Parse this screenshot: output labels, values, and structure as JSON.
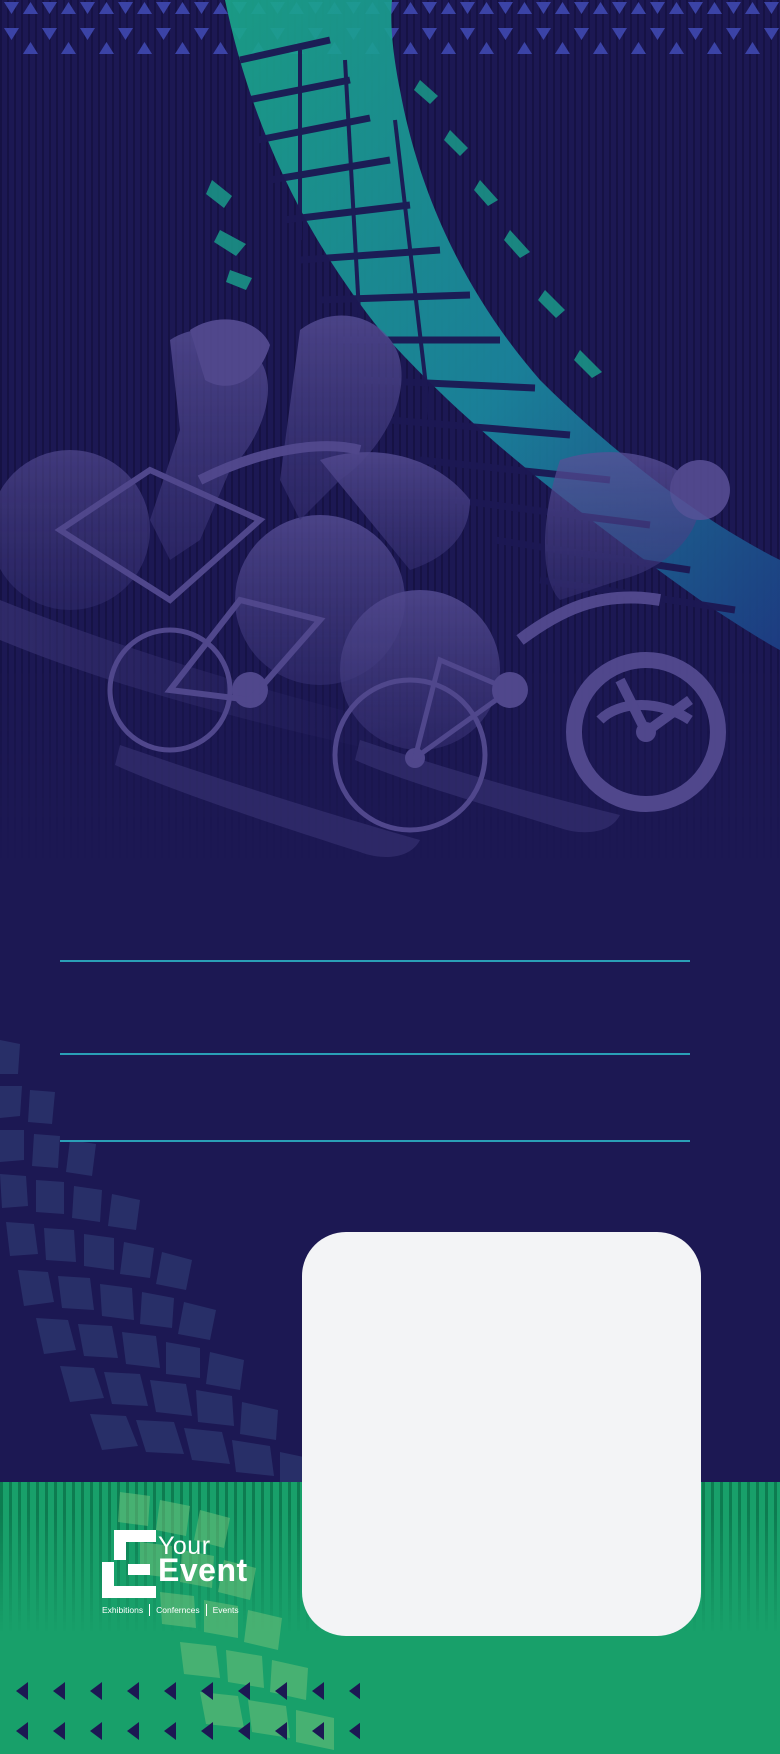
{
  "logo": {
    "line1": "Your",
    "line2": "Event",
    "tagline": [
      "Exhibitions",
      "Confernces",
      "Events"
    ]
  },
  "colors": {
    "background": "#1c1853",
    "accent_line": "#2a9fb7",
    "band_green": "#18a06a",
    "card": "#f3f4f6",
    "cyclist_silhouette": "#4f4689",
    "leaf_teal": "#1a8f8a"
  },
  "decor": {
    "top_border": "triangle-pattern",
    "hero": "cyclists-silhouette",
    "leaf": "tire-track-leaf",
    "bottom_border": "arrow-pattern"
  }
}
